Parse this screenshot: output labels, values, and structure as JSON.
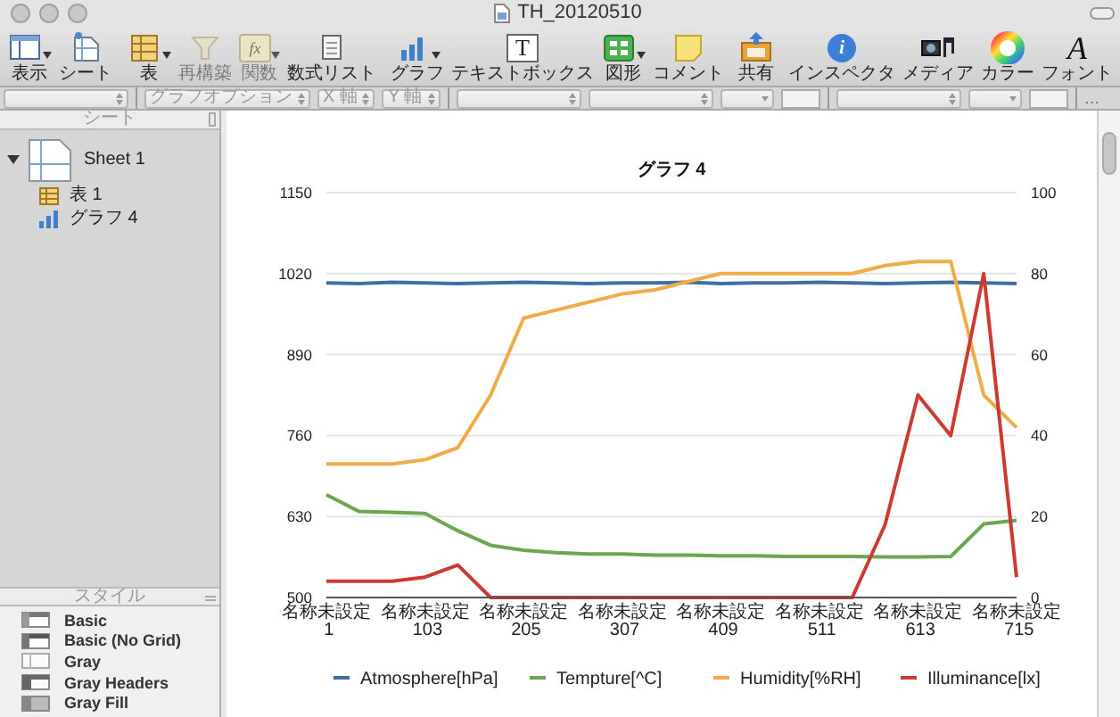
{
  "window": {
    "title": "TH_20120510"
  },
  "toolbar_groups": [
    {
      "items": [
        {
          "label": "表示",
          "kind": "view",
          "disabled": false,
          "dropdown": true
        },
        {
          "label": "シート",
          "kind": "sheet",
          "disabled": false,
          "dropdown": false
        }
      ]
    },
    {
      "items": [
        {
          "label": "表",
          "kind": "table",
          "disabled": false,
          "dropdown": true
        },
        {
          "label": "再構築",
          "kind": "reorganize",
          "disabled": true,
          "dropdown": false
        },
        {
          "label": "関数",
          "kind": "function",
          "glyph": "fx",
          "disabled": true,
          "dropdown": true
        },
        {
          "label": "数式リスト",
          "kind": "formula-list",
          "disabled": false,
          "dropdown": false
        }
      ]
    },
    {
      "items": [
        {
          "label": "グラフ",
          "kind": "chart",
          "disabled": false,
          "dropdown": true
        },
        {
          "label": "テキストボックス",
          "kind": "textbox",
          "glyph": "T",
          "disabled": false,
          "dropdown": false
        },
        {
          "label": "図形",
          "kind": "shape",
          "disabled": false,
          "dropdown": true
        },
        {
          "label": "コメント",
          "kind": "comment",
          "disabled": false,
          "dropdown": false
        }
      ]
    },
    {
      "items": [
        {
          "label": "共有",
          "kind": "share",
          "disabled": false,
          "dropdown": false
        }
      ]
    },
    {
      "items": [
        {
          "label": "インスペクタ",
          "kind": "inspector",
          "glyph": "i",
          "disabled": false,
          "dropdown": false
        },
        {
          "label": "メディア",
          "kind": "media",
          "disabled": false,
          "dropdown": false
        },
        {
          "label": "カラー",
          "kind": "colors",
          "disabled": false,
          "dropdown": false
        },
        {
          "label": "フォント",
          "kind": "fonts",
          "glyph": "A",
          "disabled": false,
          "dropdown": false
        }
      ]
    }
  ],
  "format_bar": {
    "groups": [
      {
        "items": [
          {
            "kind": "popup",
            "disabled": true
          }
        ]
      },
      {
        "items": [
          {
            "kind": "popup",
            "label": "グラフオプション",
            "disabled": true
          },
          {
            "kind": "popup",
            "label": "X 軸",
            "disabled": true
          },
          {
            "kind": "popup",
            "label": "Y 軸",
            "disabled": true
          }
        ]
      },
      {
        "items": [
          {
            "kind": "popup",
            "disabled": true
          },
          {
            "kind": "popup",
            "disabled": true
          },
          {
            "kind": "combo",
            "disabled": true
          },
          {
            "kind": "field",
            "disabled": true
          }
        ]
      },
      {
        "items": [
          {
            "kind": "popup",
            "disabled": true
          },
          {
            "kind": "combo",
            "disabled": true
          },
          {
            "kind": "field",
            "disabled": true
          }
        ]
      }
    ],
    "overflow": "…"
  },
  "sidebar": {
    "header": "シート",
    "sheets": [
      {
        "label": "Sheet 1",
        "kind": "sheet",
        "expanded": true,
        "children": [
          {
            "label": "表 1",
            "kind": "table"
          },
          {
            "label": "グラフ 4",
            "kind": "chart"
          }
        ]
      }
    ],
    "styles_header": "スタイル",
    "styles": [
      {
        "label": "Basic",
        "kind": "basic"
      },
      {
        "label": "Basic (No Grid)",
        "kind": "basic-no-grid"
      },
      {
        "label": "Gray",
        "kind": "gray"
      },
      {
        "label": "Gray Headers",
        "kind": "gray-headers"
      },
      {
        "label": "Gray Fill",
        "kind": "gray-fill"
      }
    ]
  },
  "chart": {
    "chart_data": {
      "type": "line",
      "title": "グラフ 4",
      "grid": true,
      "legend": "bottom",
      "categories": [
        "名称未設定 1",
        null,
        null,
        "名称未設定 103",
        null,
        null,
        "名称未設定 205",
        null,
        null,
        "名称未設定 307",
        null,
        null,
        "名称未設定 409",
        null,
        null,
        "名称未設定 511",
        null,
        null,
        "名称未設定 613",
        null,
        null,
        "名称未設定 715"
      ],
      "ylim": [
        500,
        1150
      ],
      "yticks": [
        500,
        630,
        760,
        890,
        1020,
        1150
      ],
      "y2lim": [
        0,
        100
      ],
      "y2ticks": [
        0,
        20,
        40,
        60,
        80,
        100
      ],
      "series": [
        {
          "name": "Atmosphere[hPa]",
          "color": "#3d6fa6",
          "values": [
            1005,
            1004,
            1006,
            1005,
            1004,
            1005,
            1006,
            1005,
            1004,
            1005,
            1005,
            1006,
            1004,
            1005,
            1005,
            1006,
            1005,
            1004,
            1005,
            1006,
            1005,
            1004
          ]
        },
        {
          "name": "Tempture[^C]",
          "color": "#6aa84f",
          "values": [
            665,
            638,
            637,
            635,
            607,
            584,
            576,
            572,
            570,
            570,
            568,
            568,
            567,
            567,
            566,
            566,
            566,
            565,
            565,
            566,
            618,
            624
          ]
        },
        {
          "name": "Humidity[%RH]",
          "color": "#f0ac48",
          "axis": "y2",
          "values": [
            33,
            33,
            33,
            34,
            37,
            50,
            69,
            71,
            73,
            75,
            76,
            78,
            80,
            80,
            80,
            80,
            80,
            82,
            83,
            83,
            50,
            42
          ]
        },
        {
          "name": "Illuminance[lx]",
          "color": "#cc3b33",
          "axis": "y2",
          "values": [
            4,
            4,
            4,
            5,
            8,
            0,
            0,
            0,
            0,
            0,
            0,
            0,
            0,
            0,
            0,
            0,
            0,
            18,
            50,
            40,
            80,
            5
          ]
        }
      ]
    }
  }
}
